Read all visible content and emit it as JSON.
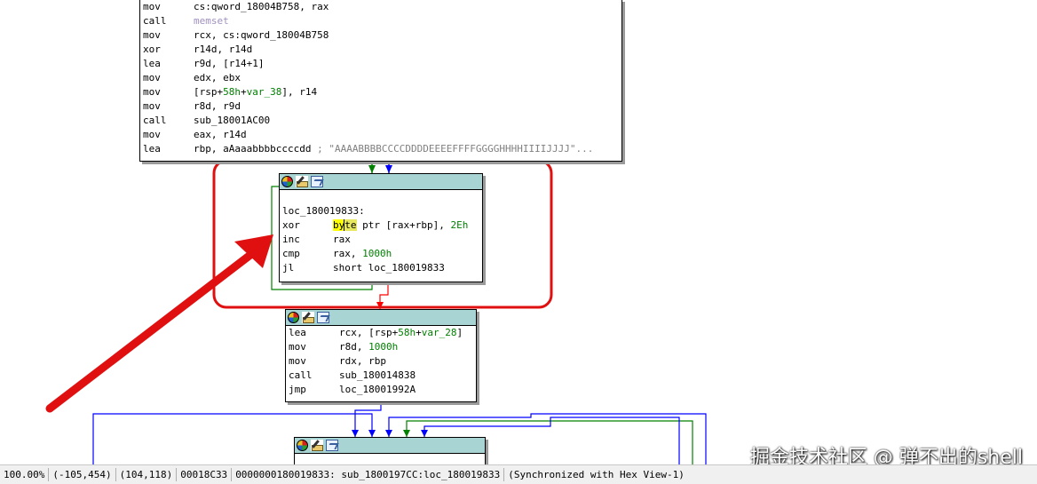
{
  "top_block": {
    "lines": [
      {
        "mnemonic": "mov",
        "parts": [
          {
            "t": "cs:qword_18004B758, rax",
            "c": ""
          }
        ]
      },
      {
        "mnemonic": "call",
        "parts": [
          {
            "t": "memset",
            "c": "imp"
          }
        ]
      },
      {
        "mnemonic": "mov",
        "parts": [
          {
            "t": "rcx, cs:qword_18004B758",
            "c": ""
          }
        ]
      },
      {
        "mnemonic": "xor",
        "parts": [
          {
            "t": "r14d, r14d",
            "c": ""
          }
        ]
      },
      {
        "mnemonic": "lea",
        "parts": [
          {
            "t": "r9d, [r14+1]",
            "c": ""
          }
        ]
      },
      {
        "mnemonic": "mov",
        "parts": [
          {
            "t": "edx, ebx",
            "c": ""
          }
        ]
      },
      {
        "mnemonic": "mov",
        "parts": [
          {
            "t": "[rsp+",
            "c": ""
          },
          {
            "t": "58h",
            "c": "num"
          },
          {
            "t": "+",
            "c": ""
          },
          {
            "t": "var_38",
            "c": "num"
          },
          {
            "t": "], r14",
            "c": ""
          }
        ]
      },
      {
        "mnemonic": "mov",
        "parts": [
          {
            "t": "r8d, r9d",
            "c": ""
          }
        ]
      },
      {
        "mnemonic": "call",
        "parts": [
          {
            "t": "sub_18001AC00",
            "c": ""
          }
        ]
      },
      {
        "mnemonic": "mov",
        "parts": [
          {
            "t": "eax, r14d",
            "c": ""
          }
        ]
      },
      {
        "mnemonic": "lea",
        "parts": [
          {
            "t": "rbp, aAaaabbbbccccdd ",
            "c": ""
          },
          {
            "t": "; \"AAAABBBBCCCCDDDDEEEEFFFFGGGGHHHHIIIIJJJJ\"...",
            "c": "cmt"
          }
        ]
      }
    ]
  },
  "loop_block": {
    "label": "loc_180019833:",
    "xor_mnemonic": "xor",
    "xor_hl1": "by",
    "xor_hl2": "te",
    "xor_rest": " ptr [rax+rbp], ",
    "xor_imm": "2Eh",
    "lines": [
      {
        "mnemonic": "inc",
        "parts": [
          {
            "t": "rax",
            "c": ""
          }
        ]
      },
      {
        "mnemonic": "cmp",
        "parts": [
          {
            "t": "rax, ",
            "c": ""
          },
          {
            "t": "1000h",
            "c": "num"
          }
        ]
      },
      {
        "mnemonic": "jl",
        "parts": [
          {
            "t": "short loc_180019833",
            "c": ""
          }
        ]
      }
    ]
  },
  "third_block": {
    "lines": [
      {
        "mnemonic": "lea",
        "parts": [
          {
            "t": "rcx, [rsp+",
            "c": ""
          },
          {
            "t": "58h",
            "c": "num"
          },
          {
            "t": "+",
            "c": ""
          },
          {
            "t": "var_28",
            "c": "num"
          },
          {
            "t": "]",
            "c": ""
          }
        ]
      },
      {
        "mnemonic": "mov",
        "parts": [
          {
            "t": "r8d, ",
            "c": ""
          },
          {
            "t": "1000h",
            "c": "num"
          }
        ]
      },
      {
        "mnemonic": "mov",
        "parts": [
          {
            "t": "rdx, rbp",
            "c": ""
          }
        ]
      },
      {
        "mnemonic": "call",
        "parts": [
          {
            "t": "sub_180014838",
            "c": ""
          }
        ]
      },
      {
        "mnemonic": "jmp",
        "parts": [
          {
            "t": "loc_18001992A",
            "c": ""
          }
        ]
      }
    ]
  },
  "toolbar_icons": [
    "set-node-color-icon",
    "rename-icon",
    "graph-overview-icon"
  ],
  "status_bar": {
    "zoom": "100.00%",
    "mouse_pos": "(-105,454)",
    "graph_pos": "(104,118)",
    "file_offset": "00018C33",
    "location": "0000000180019833: sub_1800197CC:loc_180019833",
    "sync": "(Synchronized with Hex View-1)"
  },
  "watermark": "掘金技术社区 @ 弹不出的shell",
  "colors": {
    "node_header": "#a8d4d4",
    "edge_green": "#008000",
    "edge_blue": "#0000ff",
    "edge_red": "#ff0000",
    "annotation_red": "#e01010",
    "number_green": "#008000"
  }
}
